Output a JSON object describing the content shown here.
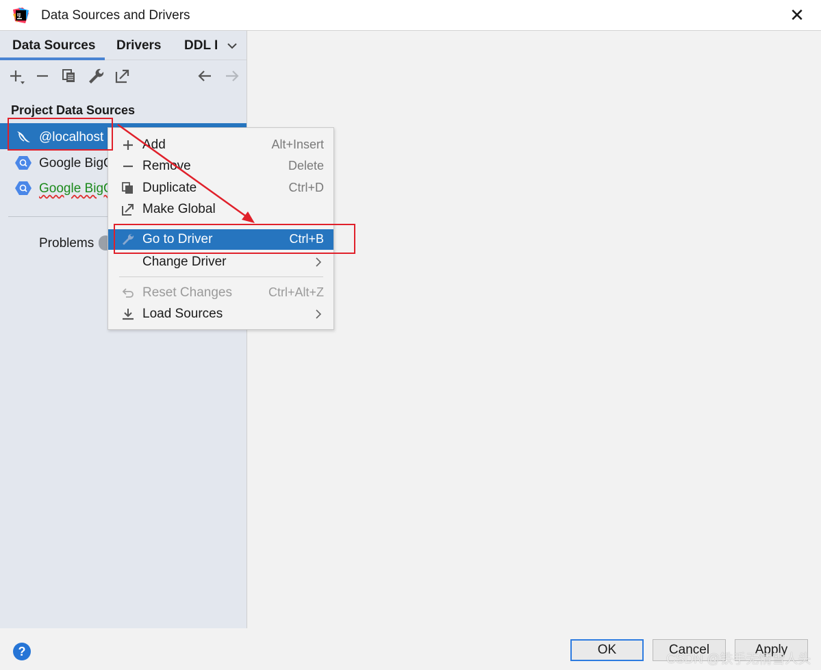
{
  "window": {
    "title": "Data Sources and Drivers",
    "close_symbol": "✕"
  },
  "tabs": [
    {
      "label": "Data Sources",
      "active": true
    },
    {
      "label": "Drivers",
      "active": false
    },
    {
      "label": "DDL I",
      "active": false
    }
  ],
  "toolbar": {
    "icons": [
      "add-icon",
      "remove-icon",
      "duplicate-icon",
      "wrench-icon",
      "make-global-icon",
      "back-arrow-icon",
      "forward-arrow-icon"
    ]
  },
  "left_panel": {
    "section_title": "Project Data Sources",
    "data_sources": [
      {
        "label": "@localhost",
        "icon": "mysql-dolphin-icon",
        "selected": true
      },
      {
        "label": "Google BigQ",
        "icon": "bigquery-icon",
        "selected": false
      },
      {
        "label": "Google BigQ",
        "icon": "bigquery-icon",
        "selected": false,
        "warning": true
      }
    ],
    "problems_label": "Problems"
  },
  "context_menu": {
    "items": [
      {
        "label": "Add",
        "shortcut": "Alt+Insert",
        "icon": "plus-icon"
      },
      {
        "label": "Remove",
        "shortcut": "Delete",
        "icon": "minus-icon"
      },
      {
        "label": "Duplicate",
        "shortcut": "Ctrl+D",
        "icon": "duplicate-icon"
      },
      {
        "label": "Make Global",
        "shortcut": "",
        "icon": "make-global-icon"
      },
      {
        "label": "Go to Driver",
        "shortcut": "Ctrl+B",
        "icon": "wrench-icon",
        "highlighted": true
      },
      {
        "label": "Change Driver",
        "shortcut": "",
        "submenu": true
      },
      {
        "label": "Reset Changes",
        "shortcut": "Ctrl+Alt+Z",
        "icon": "undo-icon",
        "disabled": true
      },
      {
        "label": "Load Sources",
        "shortcut": "",
        "icon": "download-icon",
        "submenu": true
      }
    ]
  },
  "buttons": {
    "ok": "OK",
    "cancel": "Cancel",
    "apply": "Apply",
    "help": "?"
  },
  "watermark": "CSDN @铁手无情雪人头",
  "colors": {
    "selection": "#2675bf",
    "tab_underline": "#4a84d2",
    "annotation": "#e0202a"
  }
}
